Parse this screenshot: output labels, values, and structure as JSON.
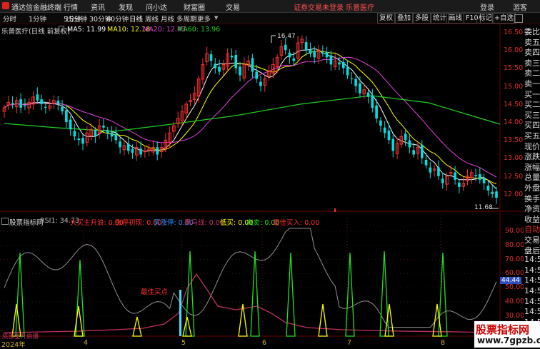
{
  "titlebar": {
    "app_name": "通达信金融终端",
    "menus": [
      "行情",
      "资讯",
      "发现",
      "问小达",
      "财富圈",
      "交易"
    ],
    "login_warning": "证券交易未登录",
    "stock_link": "乐普医疗",
    "right_items": [
      "登录",
      "游客"
    ]
  },
  "toolbar": {
    "periods": [
      "分时",
      "1分钟",
      "5分钟",
      "15分钟",
      "30分钟",
      "60分钟",
      "日线",
      "周线",
      "月线",
      "多周期",
      "更多"
    ],
    "active_period": "日线",
    "buttons": [
      "复权",
      "叠加",
      "多股",
      "统计",
      "画线",
      "F10",
      "标记",
      "+自选"
    ]
  },
  "main_info": {
    "stock_label": "乐普医疗(日线 前复权)",
    "ma": [
      {
        "label": "MA5: 11.99",
        "color": "#ffffff"
      },
      {
        "label": "MA10: 12.18",
        "color": "#ffff00"
      },
      {
        "label": "MA20: 12.43",
        "color": "#e040e0"
      },
      {
        "label": "MA60: 13.96",
        "color": "#20d020"
      }
    ]
  },
  "indicator_info": {
    "name": "股票指标网",
    "rsi": "RSI1: 34.73",
    "fields": [
      {
        "label": "大买主升浪: 0.00",
        "color": "#ff3030"
      },
      {
        "label": "涨停初现: 0.00",
        "color": "#ff3030"
      },
      {
        "label": "买涨停: 0.00",
        "color": "#3a8cff"
      },
      {
        "label": "黑马线: 0.00",
        "color": "#c03060"
      },
      {
        "label": "低买: 0.00",
        "color": "#ffff00"
      },
      {
        "label": "高卖: 0.00",
        "color": "#20e020"
      },
      {
        "label": "最佳买入: 0.00",
        "color": "#ff3030"
      }
    ],
    "bottom_tag": "底部主升启爆",
    "annotation": "最佳买点"
  },
  "price_axis": [
    "16.50",
    "16.00",
    "15.50",
    "15.00",
    "14.50",
    "14.00",
    "13.50",
    "13.00",
    "12.50",
    "12.00"
  ],
  "indicator_axis": [
    "90.00",
    "80.00",
    "70.00",
    "60.00",
    "50.00",
    "40.00",
    "30.00",
    "20.00"
  ],
  "rsi_tag": "44.44",
  "high_label": "16.47",
  "low_label": "11.68",
  "x_labels": [
    "2024年",
    "4",
    "5",
    "6",
    "7",
    "8"
  ],
  "quote_panel": [
    {
      "t": "委比",
      "c": "#dddddd"
    },
    {
      "t": "卖五",
      "c": "#dddddd"
    },
    {
      "t": "卖四",
      "c": "#dddddd"
    },
    {
      "t": "卖三",
      "c": "#dddddd"
    },
    {
      "t": "卖二",
      "c": "#dddddd"
    },
    {
      "t": "卖一",
      "c": "#dddddd"
    },
    {
      "t": "买一",
      "c": "#dddddd"
    },
    {
      "t": "买二",
      "c": "#dddddd"
    },
    {
      "t": "买三",
      "c": "#dddddd"
    },
    {
      "t": "买四",
      "c": "#dddddd"
    },
    {
      "t": "买五",
      "c": "#dddddd"
    },
    {
      "t": "现价",
      "c": "#dddddd"
    },
    {
      "t": "涨跌",
      "c": "#dddddd"
    },
    {
      "t": "涨幅",
      "c": "#dddddd"
    },
    {
      "t": "总量",
      "c": "#dddddd"
    },
    {
      "t": "外盘",
      "c": "#dddddd"
    },
    {
      "t": "换手",
      "c": "#dddddd"
    },
    {
      "t": "净资",
      "c": "#dddddd"
    },
    {
      "t": "收益",
      "c": "#dddddd"
    },
    {
      "t": "自动",
      "c": "#e03030"
    },
    {
      "t": "交易",
      "c": "#dddddd"
    },
    {
      "t": "盘后",
      "c": "#dddddd"
    },
    {
      "t": "14:5",
      "c": "#dddddd"
    },
    {
      "t": "14:5",
      "c": "#dddddd"
    },
    {
      "t": "14:5",
      "c": "#dddddd"
    },
    {
      "t": "14:5",
      "c": "#dddddd"
    },
    {
      "t": "14:5",
      "c": "#dddddd"
    },
    {
      "t": "14:5",
      "c": "#dddddd"
    },
    {
      "t": "14:5",
      "c": "#dddddd"
    },
    {
      "t": "14:5",
      "c": "#dddddd"
    }
  ],
  "watermark": {
    "line1": "股票指标网",
    "line2": "www.7gpzb.com"
  },
  "colors": {
    "up": "#ff3030",
    "down": "#00e0e0",
    "ma5": "#ffffff",
    "ma10": "#ffff00",
    "ma20": "#e040e0",
    "ma60": "#20d020"
  }
}
